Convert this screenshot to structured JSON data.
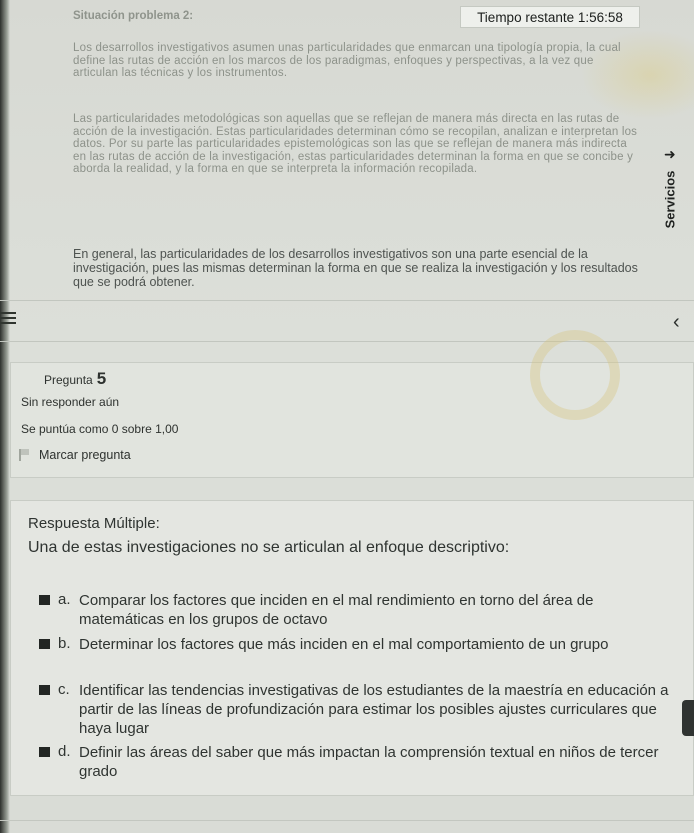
{
  "timer": {
    "label": "Tiempo restante",
    "value": "1:56:58"
  },
  "reading": {
    "title": "Situación problema 2:",
    "paragraph1": "Los desarrollos investigativos asumen unas particularidades que enmarcan una tipología propia, la cual define las rutas de acción en los marcos de los paradigmas, enfoques y perspectivas, a la vez que articulan las técnicas y los instrumentos.",
    "paragraph2": "Las particularidades metodológicas son aquellas que se reflejan de manera más directa en las rutas de acción de la investigación. Estas particularidades determinan cómo se recopilan, analizan e interpretan los datos. Por su parte las particularidades epistemológicas son las que se reflejan de manera más indirecta en las rutas de acción de la investigación, estas particularidades determinan la forma en que se concibe y aborda la realidad, y la forma en que se interpreta la información recopilada.",
    "paragraph3": "En general, las particularidades de los desarrollos investigativos son una parte esencial de la investigación, pues las mismas determinan la forma en que se realiza la investigación y los resultados que se podrá obtener."
  },
  "services_tab": {
    "label": "Servicios"
  },
  "question": {
    "label": "Pregunta",
    "number": "5",
    "status": "Sin responder aún",
    "score": "Se puntúa como 0 sobre 1,00",
    "flag_label": "Marcar pregunta"
  },
  "answer": {
    "type_label": "Respuesta Múltiple:",
    "prompt": "Una de estas investigaciones no se articulan al enfoque descriptivo:",
    "options": [
      {
        "letter": "a.",
        "text": "Comparar los factores que inciden en el mal rendimiento en torno del área de matemáticas en los grupos de octavo"
      },
      {
        "letter": "b.",
        "text": "Determinar los factores que más inciden en el mal comportamiento de un grupo"
      },
      {
        "letter": "c.",
        "text": "Identificar las tendencias investigativas de los estudiantes de la maestría en educación a partir de las líneas de profundización para estimar los posibles ajustes curriculares que haya lugar"
      },
      {
        "letter": "d.",
        "text": "Definir las áreas del saber que más impactan la comprensión textual en niños de tercer grado"
      }
    ]
  }
}
